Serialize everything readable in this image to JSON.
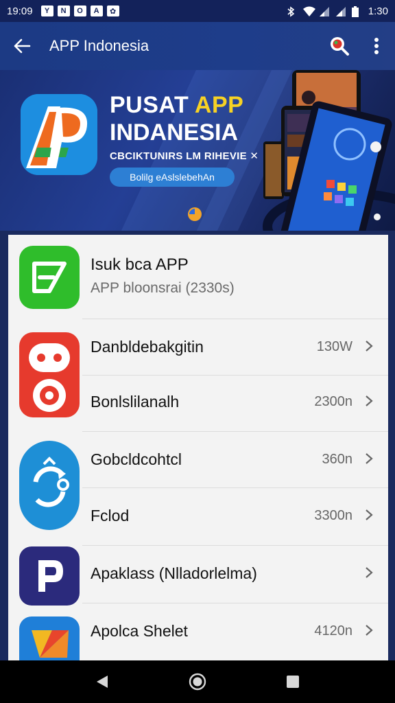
{
  "status_bar": {
    "time": "19:09",
    "notif_icons": [
      "Y",
      "N",
      "O",
      "A",
      "✿"
    ],
    "right_time": "1:30"
  },
  "app_bar": {
    "title": "APP Indonesia"
  },
  "banner": {
    "title_part1": "PUSAT ",
    "title_highlight": "APP",
    "title_line2": "INDANESIA",
    "subtitle": "CBCIKTUNIRS LM RIHEVIE ✕",
    "pill_text": "Bolilg eAslslebehAn",
    "colors": {
      "highlight": "#f7d224",
      "pill": "#2d7fd4"
    }
  },
  "list": {
    "header": {
      "title": "Isuk bca APP",
      "subtitle": "APP bloonsrai (2330s)",
      "icon": "green-app-icon"
    },
    "rows": [
      {
        "name": "Danbldebakgitin",
        "value": "130W"
      },
      {
        "name": "Bonlslilanalh",
        "value": "2300n"
      },
      {
        "name": "Gobcldcohtcl",
        "value": "360n"
      },
      {
        "name": "Fclod",
        "value": "3300n"
      },
      {
        "name": "Apaklass (Nlladorlelma)",
        "value": ""
      },
      {
        "name": "Apolca Shelet",
        "value": "4120n"
      }
    ]
  },
  "nav": {
    "back": "back-triangle-icon",
    "home": "home-circle-icon",
    "recents": "recents-square-icon"
  }
}
